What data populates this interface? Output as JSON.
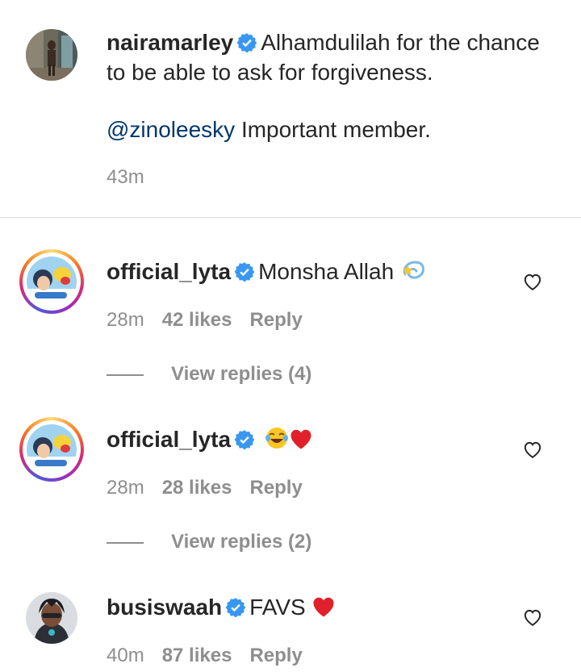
{
  "caption": {
    "username": "nairamarley",
    "text_line1": "Alhamdulilah for the chance",
    "text_line2": "to be able to ask for forgiveness.",
    "mention": "@zinoleesky",
    "text_line3": "Important member.",
    "time": "43m"
  },
  "comments": [
    {
      "username": "official_lyta",
      "text": "Monsha Allah",
      "emojis": [
        "dizzy"
      ],
      "time": "28m",
      "likes": "42 likes",
      "reply": "Reply",
      "view_replies": "View replies (4)"
    },
    {
      "username": "official_lyta",
      "text": "",
      "emojis": [
        "joy",
        "red-heart"
      ],
      "time": "28m",
      "likes": "28 likes",
      "reply": "Reply",
      "view_replies": "View replies (2)"
    },
    {
      "username": "busiswaah",
      "text": "FAVS",
      "emojis": [
        "red-heart"
      ],
      "time": "40m",
      "likes": "87 likes",
      "reply": "Reply"
    }
  ],
  "colors": {
    "text": "#262626",
    "secondary": "#8e8e8e",
    "mention": "#00376b",
    "verified": "#3897f0",
    "divider": "#dbdbdb"
  },
  "icons": [
    "verified-badge-icon",
    "heart-outline-icon"
  ]
}
